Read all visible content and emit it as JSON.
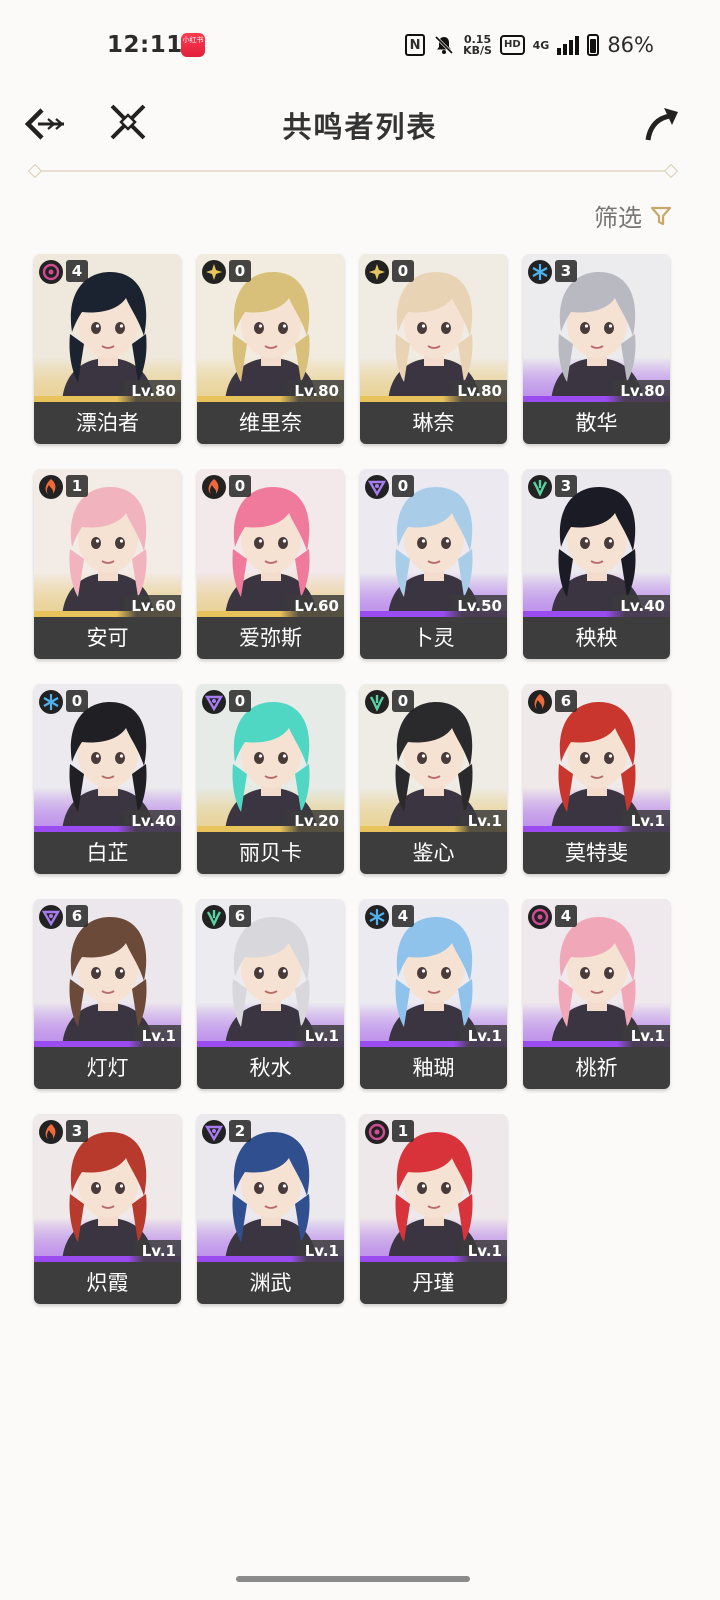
{
  "status_bar": {
    "time": "12:11",
    "app_badge": "小红书",
    "speed_value": "0.15",
    "speed_unit": "KB/S",
    "hd": "HD",
    "network": "4G",
    "battery": "86%"
  },
  "header": {
    "title": "共鸣者列表"
  },
  "filter": {
    "label": "筛选"
  },
  "colors": {
    "gold": "#c8a86a",
    "purple_rarity": "#9a4cf0",
    "gold_rarity": "#e8c25a",
    "name_bar": "#3d3d3d"
  },
  "characters": [
    {
      "name": "漂泊者",
      "level": "Lv.80",
      "seq": "4",
      "element": "havoc",
      "rarity": "gold",
      "hair": "#1c2330",
      "bg": "#efe9dd"
    },
    {
      "name": "维里奈",
      "level": "Lv.80",
      "seq": "0",
      "element": "spectro",
      "rarity": "gold",
      "hair": "#d9c07a",
      "bg": "#f1ecdf"
    },
    {
      "name": "琳奈",
      "level": "Lv.80",
      "seq": "0",
      "element": "spectro",
      "rarity": "gold",
      "hair": "#e9d3b5",
      "bg": "#f0ebe3"
    },
    {
      "name": "散华",
      "level": "Lv.80",
      "seq": "3",
      "element": "glacio",
      "rarity": "purple",
      "hair": "#b9b9c2",
      "bg": "#ecebee"
    },
    {
      "name": "安可",
      "level": "Lv.60",
      "seq": "1",
      "element": "fusion",
      "rarity": "gold",
      "hair": "#f1b3bd",
      "bg": "#f2ebe6"
    },
    {
      "name": "爱弥斯",
      "level": "Lv.60",
      "seq": "0",
      "element": "fusion",
      "rarity": "gold",
      "hair": "#f07a9c",
      "bg": "#f3e8ea"
    },
    {
      "name": "卜灵",
      "level": "Lv.50",
      "seq": "0",
      "element": "electro",
      "rarity": "purple",
      "hair": "#a9cde8",
      "bg": "#eceaf0"
    },
    {
      "name": "秧秧",
      "level": "Lv.40",
      "seq": "3",
      "element": "aero",
      "rarity": "purple",
      "hair": "#1b1b26",
      "bg": "#ebe8ee"
    },
    {
      "name": "白芷",
      "level": "Lv.40",
      "seq": "0",
      "element": "glacio",
      "rarity": "purple",
      "hair": "#1f1f24",
      "bg": "#eceaee"
    },
    {
      "name": "丽贝卡",
      "level": "Lv.20",
      "seq": "0",
      "element": "electro",
      "rarity": "gold",
      "hair": "#4fd7c3",
      "bg": "#e6ebe8"
    },
    {
      "name": "鉴心",
      "level": "Lv.1",
      "seq": "0",
      "element": "aero",
      "rarity": "gold",
      "hair": "#2a2a2c",
      "bg": "#efece5"
    },
    {
      "name": "莫特斐",
      "level": "Lv.1",
      "seq": "6",
      "element": "fusion",
      "rarity": "purple",
      "hair": "#c8362e",
      "bg": "#efe9e9"
    },
    {
      "name": "灯灯",
      "level": "Lv.1",
      "seq": "6",
      "element": "electro",
      "rarity": "purple",
      "hair": "#6b4a3a",
      "bg": "#ece7ec"
    },
    {
      "name": "秋水",
      "level": "Lv.1",
      "seq": "6",
      "element": "aero",
      "rarity": "purple",
      "hair": "#d7d7dc",
      "bg": "#ecebef"
    },
    {
      "name": "釉瑚",
      "level": "Lv.1",
      "seq": "4",
      "element": "glacio",
      "rarity": "purple",
      "hair": "#8fc3ec",
      "bg": "#eceaf1"
    },
    {
      "name": "桃祈",
      "level": "Lv.1",
      "seq": "4",
      "element": "havoc",
      "rarity": "purple",
      "hair": "#f0a8b8",
      "bg": "#efe9ee"
    },
    {
      "name": "炽霞",
      "level": "Lv.1",
      "seq": "3",
      "element": "fusion",
      "rarity": "purple",
      "hair": "#b83a2c",
      "bg": "#efe9ea"
    },
    {
      "name": "渊武",
      "level": "Lv.1",
      "seq": "2",
      "element": "electro",
      "rarity": "purple",
      "hair": "#2f4f8f",
      "bg": "#ebe9ee"
    },
    {
      "name": "丹瑾",
      "level": "Lv.1",
      "seq": "1",
      "element": "havoc",
      "rarity": "purple",
      "hair": "#d8323a",
      "bg": "#efe8ea"
    }
  ]
}
